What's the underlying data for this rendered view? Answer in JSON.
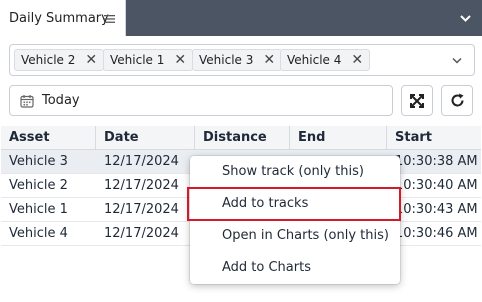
{
  "tab": {
    "title": "Daily Summary"
  },
  "vehicles": {
    "chips": [
      {
        "label": "Vehicle 2"
      },
      {
        "label": "Vehicle 1"
      },
      {
        "label": "Vehicle 3"
      },
      {
        "label": "Vehicle 4"
      }
    ],
    "remove_glyph": "✕"
  },
  "date": {
    "value": "Today"
  },
  "grid": {
    "columns": [
      "Asset",
      "Date",
      "Distance",
      "End",
      "Start"
    ],
    "rows": [
      {
        "asset": "Vehicle 3",
        "date": "12/17/2024",
        "start": "10:30:38 AM",
        "selected": true
      },
      {
        "asset": "Vehicle 2",
        "date": "12/17/2024",
        "start": "10:30:40 AM",
        "selected": false
      },
      {
        "asset": "Vehicle 1",
        "date": "12/17/2024",
        "start": "10:30:43 AM",
        "selected": false
      },
      {
        "asset": "Vehicle 4",
        "date": "12/17/2024",
        "start": "10:30:46 AM",
        "selected": false
      }
    ]
  },
  "context_menu": {
    "items": [
      {
        "label": "Show track (only this)"
      },
      {
        "label": "Add to tracks",
        "highlighted": true
      },
      {
        "label": "Open in Charts (only this)"
      },
      {
        "label": "Add to Charts"
      }
    ]
  },
  "colors": {
    "tabbar": "#4b5563",
    "highlight_outline": "#d11a2a",
    "selected_row": "#eaeef3"
  },
  "icons": {
    "tab_menu": "hamburger-icon",
    "tabbar_toggle": "chevron-down-icon",
    "select_toggle": "chevron-down-icon",
    "date": "calendar-icon",
    "expand": "expand-icon",
    "refresh": "refresh-icon"
  }
}
